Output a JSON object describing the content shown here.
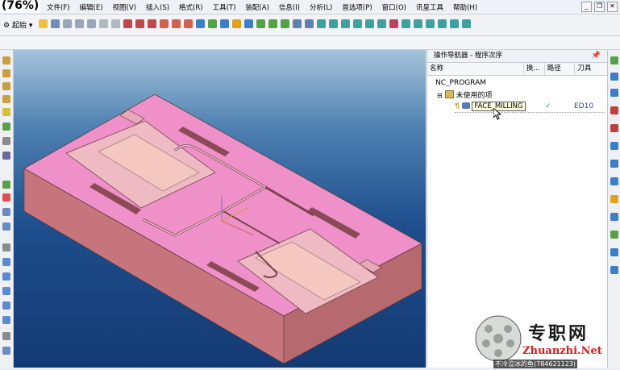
{
  "zoom_label": "(76%)",
  "menu": [
    "文件(F)",
    "编辑(E)",
    "视图(V)",
    "插入(S)",
    "格式(R)",
    "工具(T)",
    "装配(A)",
    "信息(I)",
    "分析(L)",
    "首选项(P)",
    "窗口(O)",
    "讯呈工具",
    "帮助(H)"
  ],
  "toolbar": {
    "start_label": "起始"
  },
  "navigator": {
    "title": "操作导航器 - 程序次序",
    "columns": [
      "名称",
      "换...",
      "路径",
      "刀具"
    ],
    "rows": [
      {
        "name": "NC_PROGRAM"
      },
      {
        "name": "未使用的项"
      },
      {
        "name": "FACE_MILLING",
        "path_status": "✓",
        "tool": "ED10"
      }
    ]
  },
  "watermark": {
    "brand": "专职网",
    "site": "Zhuanzhi.Net",
    "caption": "不冷泣冰的鱼(784621123)"
  },
  "colors": {
    "part_pink": "#f090c8",
    "viewport_top": "#a4c3da",
    "viewport_bottom": "#143a74"
  }
}
